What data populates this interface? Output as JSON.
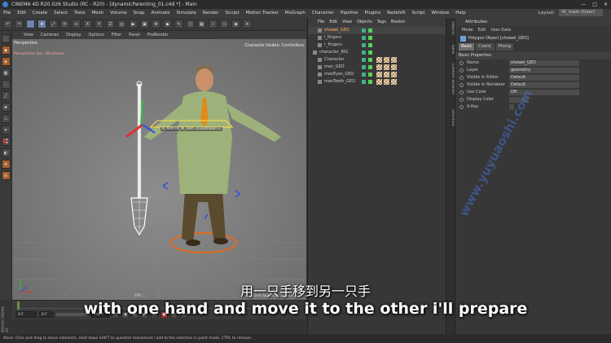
{
  "window": {
    "title": "CINEMA 4D R20.026 Studio (RC - R20) - [dynamicParenting_01.c4d *] - Main"
  },
  "menu": [
    "File",
    "Edit",
    "Create",
    "Select",
    "Tools",
    "Mesh",
    "Volume",
    "Snap",
    "Animate",
    "Simulate",
    "Render",
    "Sculpt",
    "Motion Tracker",
    "MoGraph",
    "Character",
    "Pipeline",
    "Plugins",
    "Redshift",
    "Script",
    "Window",
    "Help"
  ],
  "layout": {
    "label": "Layout:",
    "value": "Vt_main (User)"
  },
  "toolbar": {
    "x": "X",
    "y": "Y",
    "z": "Z"
  },
  "viewport": {
    "menu": [
      "View",
      "Cameras",
      "Display",
      "Options",
      "Filter",
      "Panel",
      "ProRender"
    ],
    "label": "Perspective",
    "sublabel": "Perspective.Sel.: Wireframe",
    "right_label": "Character.Visible: Controllers",
    "controller_label": "R_Arm (R_IK_Arm <Controller>)",
    "fps": "FPS : ...",
    "grid_spacing": "Grid Spacing : 100 cm"
  },
  "playback": {
    "start": "0 F",
    "current": "0 F",
    "end": "100 F",
    "frame": "1"
  },
  "status": "Move: Click and drag to move elements. Hold down SHIFT to quantize movement / add to the selection in point mode, CTRL to remove.",
  "side_logo": "MAXON CINEMA 4D",
  "object_manager": {
    "tabs": [
      "File",
      "Edit",
      "View",
      "Objects",
      "Tags",
      "Bookm"
    ],
    "rows": [
      {
        "name": "showel_GEO",
        "indent": 1,
        "selected": true
      },
      {
        "name": "l_fingers",
        "indent": 1,
        "selected": false
      },
      {
        "name": "r_fingers",
        "indent": 1,
        "selected": false
      },
      {
        "name": "character_RIG",
        "indent": 0,
        "selected": false
      },
      {
        "name": "Character",
        "indent": 1,
        "selected": false
      },
      {
        "name": "man_GEO",
        "indent": 1,
        "selected": false
      },
      {
        "name": "manEyes_GEO",
        "indent": 1,
        "selected": false
      },
      {
        "name": "manTeeth_GEO",
        "indent": 1,
        "selected": false
      }
    ]
  },
  "side_tabs": [
    "Objects",
    "Takes",
    "Content Browser",
    "Structure"
  ],
  "attributes": {
    "title": "Attributes",
    "menu": [
      "Mode",
      "Edit",
      "User Data"
    ],
    "object": "Polygon Object [showel_GEO]",
    "tabs": [
      "Basic",
      "Coord.",
      "Phong"
    ],
    "section": "Basic Properties",
    "rows": [
      {
        "label": "Name",
        "value": "showel_GEO"
      },
      {
        "label": "Layer",
        "value": "geometry"
      },
      {
        "label": "Visible in Editor",
        "value": "Default"
      },
      {
        "label": "Visible in Renderer",
        "value": "Default"
      },
      {
        "label": "Use Color",
        "value": "Off"
      },
      {
        "label": "Display Color",
        "value": ""
      },
      {
        "label": "X-Ray",
        "value": ""
      }
    ]
  },
  "subtitles": {
    "cn": "用一只手移到另一只手",
    "en": "with one hand and move it to the other i'll prepare"
  },
  "watermark": "www.yuyuaoshi.com"
}
